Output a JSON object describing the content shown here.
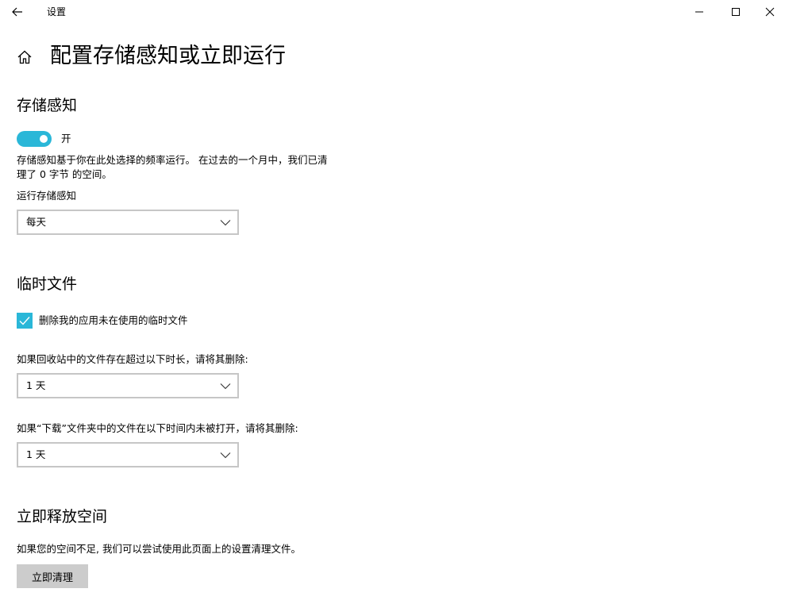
{
  "window": {
    "app_title": "设置",
    "back_icon": "back-arrow-icon",
    "minimize_icon": "minimize-icon",
    "maximize_icon": "maximize-icon",
    "close_icon": "close-icon"
  },
  "header": {
    "home_icon": "home-icon",
    "title": "配置存储感知或立即运行"
  },
  "storage_sense": {
    "heading": "存储感知",
    "toggle_state": "on",
    "toggle_label": "开",
    "description_line1": "存储感知基于你在此处选择的频率运行。 在过去的一个月中，我们已清",
    "description_line2": "理了 0 字节 的空间。",
    "run_label": "运行存储感知",
    "run_value": "每天"
  },
  "temp_files": {
    "heading": "临时文件",
    "checkbox_checked": true,
    "checkbox_label": "删除我的应用未在使用的临时文件",
    "recycle_label": "如果回收站中的文件存在超过以下时长，请将其删除:",
    "recycle_value": "1 天",
    "downloads_label": "如果“下载”文件夹中的文件在以下时间内未被打开，请将其删除:",
    "downloads_value": "1 天"
  },
  "free_space": {
    "heading": "立即释放空间",
    "description": "如果您的空间不足, 我们可以尝试使用此页面上的设置清理文件。",
    "button_label": "立即清理"
  },
  "colors": {
    "accent": "#2ab7d8",
    "button_bg": "#cccccc",
    "border": "#c6c6c6"
  }
}
